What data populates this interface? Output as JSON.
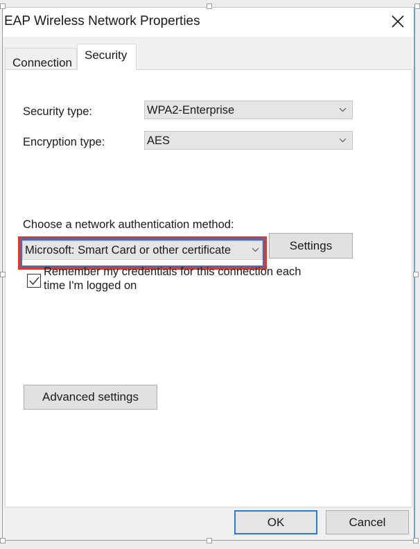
{
  "window": {
    "title": "EAP Wireless Network Properties",
    "close_icon": "close-icon"
  },
  "tabs": [
    {
      "label": "Connection",
      "active": false
    },
    {
      "label": "Security",
      "active": true
    }
  ],
  "security": {
    "security_type_label": "Security type:",
    "security_type_value": "WPA2-Enterprise",
    "encryption_type_label": "Encryption type:",
    "encryption_type_value": "AES",
    "auth_method_label": "Choose a network authentication method:",
    "auth_method_value": "Microsoft: Smart Card or other certificate",
    "settings_button": "Settings",
    "remember_credentials_line1": "Remember my credentials for this connection each",
    "remember_credentials_line2": "time I'm logged on",
    "remember_credentials_checked": true,
    "advanced_settings_button": "Advanced settings"
  },
  "footer": {
    "ok_button": "OK",
    "cancel_button": "Cancel"
  },
  "colors": {
    "highlight_outer": "#d93a2b",
    "highlight_inner": "#4a6bb5",
    "default_button_border": "#2b79d0"
  }
}
